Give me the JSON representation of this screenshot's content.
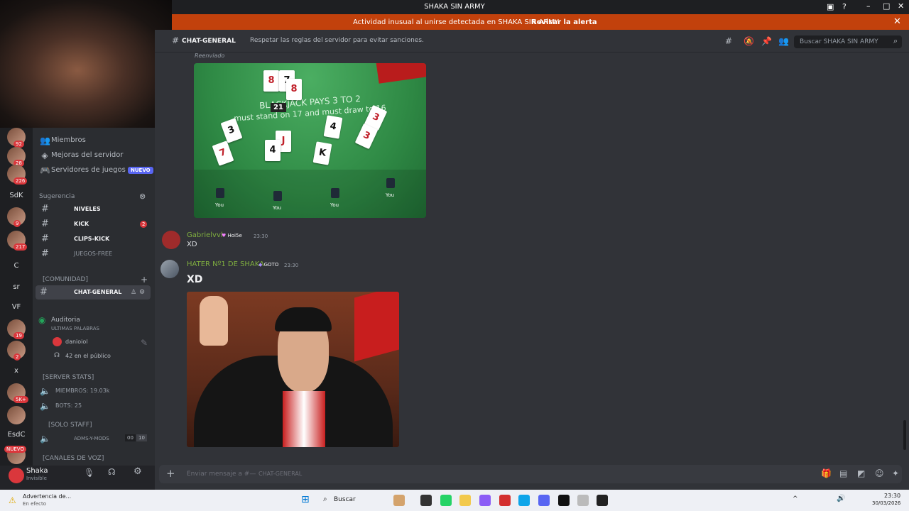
{
  "window": {
    "title": "SHAKA SIN ARMY"
  },
  "alert": {
    "message": "Actividad inusual al unirse detectada en SHAKA SIN ARMY",
    "action": "Revisar la alerta"
  },
  "servers": [
    {
      "label": "",
      "badge": "92"
    },
    {
      "label": "",
      "badge": "28"
    },
    {
      "label": "",
      "badge": "226"
    },
    {
      "label": "SdK",
      "badge": ""
    },
    {
      "label": "",
      "badge": "9"
    },
    {
      "label": "",
      "badge": "217"
    },
    {
      "label": "C",
      "badge": ""
    },
    {
      "label": "sr",
      "badge": ""
    },
    {
      "label": "VF",
      "badge": ""
    },
    {
      "label": "",
      "badge": "19"
    },
    {
      "label": "",
      "badge": "2"
    },
    {
      "label": "x",
      "badge": ""
    },
    {
      "label": "",
      "badge": "5K+"
    },
    {
      "label": "",
      "badge": ""
    },
    {
      "label": "EsdC",
      "badge": ""
    },
    {
      "label": "",
      "badge": "NUEVO"
    }
  ],
  "sidebar": {
    "members": "Miembros",
    "boosts": "Mejoras del servidor",
    "game_servers": "Servidores de juegos",
    "game_servers_badge": "NUEVO",
    "suggestion_label": "Sugerencia",
    "channels": [
      {
        "name": "NIVELES",
        "badge": ""
      },
      {
        "name": "KICK",
        "badge": "2"
      },
      {
        "name": "CLIPS-KICK",
        "badge": ""
      },
      {
        "name": "JUEGOS-FREE",
        "badge": ""
      }
    ],
    "community_cat": "[COMUNIDAD]",
    "active_channel": "CHAT-GENERAL",
    "stage": {
      "name": "Auditoria",
      "topic": "ULTIMAS PALABRAS",
      "speaker": "danioiol",
      "audience": "42 en el público"
    },
    "stats_cat": "[SERVER STATS]",
    "stats": [
      "MIEMBROS: 19.03k",
      "BOTS: 25"
    ],
    "staff_cat": "[SOLO STAFF]",
    "staff_channel": "ADMS-Y-MODS",
    "staff_counts": [
      "00",
      "10"
    ],
    "voice_cat": "[CANALES DE VOZ]"
  },
  "user": {
    "name": "Shaka",
    "status": "Invisible"
  },
  "channel_header": {
    "name": "CHAT-GENERAL",
    "topic": "Respetar las reglas del servidor para evitar sanciones.",
    "search_placeholder": "Buscar SHAKA SIN ARMY"
  },
  "messages": [
    {
      "forwarded_label": "Reenviado",
      "image": {
        "labels": [
          "BLACKJACK PAYS 3 TO 2",
          "must stand on 17 and must draw to 16"
        ],
        "score": "21",
        "seats": [
          "You",
          "You",
          "You",
          "You"
        ]
      }
    },
    {
      "author": "Gabrielvvl",
      "tag": "Hoi5e",
      "time": "23:30",
      "text": "XD"
    },
    {
      "author": "HATER Nº1 DE SHAKA",
      "tag": "GOTO",
      "time": "23:30",
      "text": "XD"
    }
  ],
  "composer": {
    "placeholder": "Enviar mensaje a #—",
    "channel": "CHAT-GENERAL"
  },
  "taskbar": {
    "weather_title": "Advertencia de...",
    "weather_sub": "En efecto",
    "search": "Buscar",
    "time": "23:30",
    "date": "30/03/2026"
  },
  "colors": {
    "accent": "#5865f2",
    "alert": "#c2410c",
    "danger": "#da373c",
    "online": "#23a55a"
  }
}
